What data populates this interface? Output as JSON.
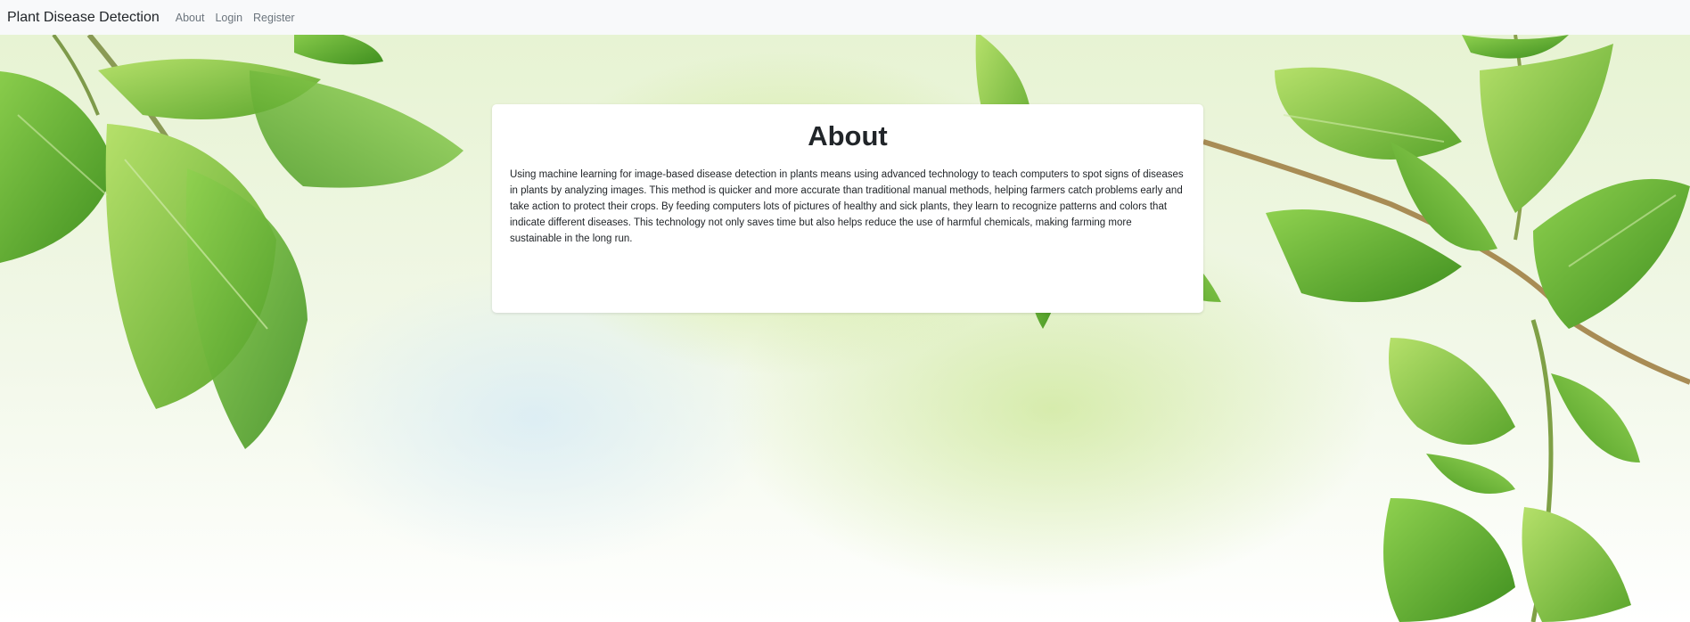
{
  "navbar": {
    "brand": "Plant Disease Detection",
    "links": [
      "About",
      "Login",
      "Register"
    ]
  },
  "about": {
    "title": "About",
    "body": "Using machine learning for image-based disease detection in plants means using advanced technology to teach computers to spot signs of diseases in plants by analyzing images. This method is quicker and more accurate than traditional manual methods, helping farmers catch problems early and take action to protect their crops. By feeding computers lots of pictures of healthy and sick plants, they learn to recognize patterns and colors that indicate different diseases. This technology not only saves time but also helps reduce the use of harmful chemicals, making farming more sustainable in the long run."
  },
  "colors": {
    "navbar_bg": "#f8f9fa",
    "leaf_green": "#6cb83a",
    "card_bg": "#ffffff"
  }
}
